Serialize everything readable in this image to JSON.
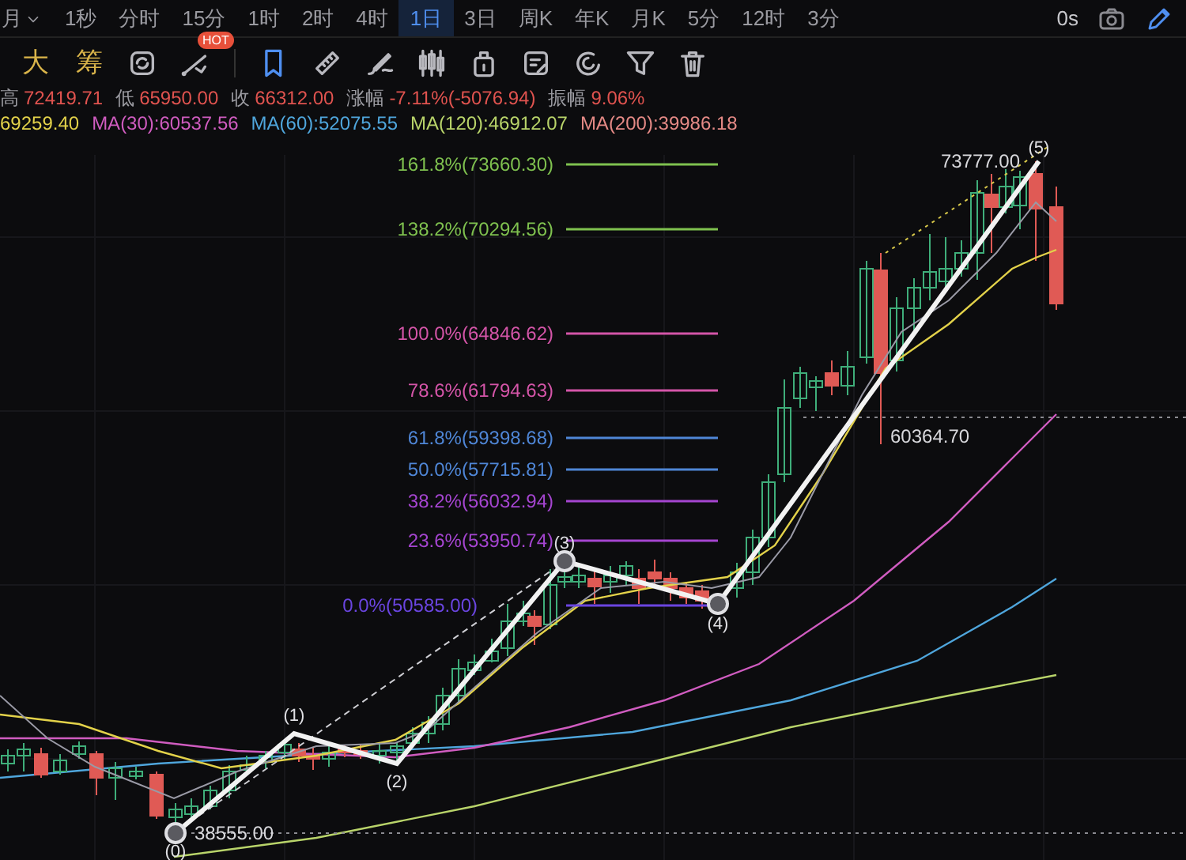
{
  "header": {
    "period_menu": "月",
    "tabs": [
      {
        "label": "1秒",
        "selected": false
      },
      {
        "label": "分时",
        "selected": false
      },
      {
        "label": "15分",
        "selected": false
      },
      {
        "label": "1时",
        "selected": false
      },
      {
        "label": "2时",
        "selected": false
      },
      {
        "label": "4时",
        "selected": false
      },
      {
        "label": "1日",
        "selected": true
      },
      {
        "label": "3日",
        "selected": false
      },
      {
        "label": "周K",
        "selected": false
      },
      {
        "label": "年K",
        "selected": false
      },
      {
        "label": "月K",
        "selected": false
      },
      {
        "label": "5分",
        "selected": false
      },
      {
        "label": "12时",
        "selected": false
      },
      {
        "label": "3分",
        "selected": false
      }
    ],
    "timer": "0s"
  },
  "toolbar": {
    "text_tools": [
      "大",
      "筹"
    ],
    "hot_badge": "HOT"
  },
  "stats": [
    {
      "label": "高",
      "value": "72419.71"
    },
    {
      "label": "低",
      "value": "65950.00"
    },
    {
      "label": "收",
      "value": "66312.00"
    },
    {
      "label": "涨幅",
      "value": "-7.11%(-5076.94)"
    },
    {
      "label": "振幅",
      "value": "9.06%"
    }
  ],
  "moving_averages": [
    {
      "label": "69259.40",
      "color": "#e3d24a"
    },
    {
      "label": "MA(30):60537.56",
      "color": "#d05cc0"
    },
    {
      "label": "MA(60):52075.55",
      "color": "#4fa6dc"
    },
    {
      "label": "MA(120):46912.07",
      "color": "#b9d46a"
    },
    {
      "label": "MA(200):39986.18",
      "color": "#e58a86"
    }
  ],
  "chart": {
    "fib_levels": [
      {
        "label": "161.8%(73660.30)",
        "color": "#7fc14f"
      },
      {
        "label": "138.2%(70294.56)",
        "color": "#7fc14f"
      },
      {
        "label": "100.0%(64846.62)",
        "color": "#d455a8"
      },
      {
        "label": "78.6%(61794.63)",
        "color": "#d455a8"
      },
      {
        "label": "61.8%(59398.68)",
        "color": "#4f86d6"
      },
      {
        "label": "50.0%(57715.81)",
        "color": "#4f86d6"
      },
      {
        "label": "38.2%(56032.94)",
        "color": "#a545d0"
      },
      {
        "label": "23.6%(53950.74)",
        "color": "#a545d0"
      },
      {
        "label": "0.0%(50585.00)",
        "color": "#6a45e0"
      }
    ],
    "waves": [
      "(0)",
      "(1)",
      "(2)",
      "(3)",
      "(4)",
      "(5)"
    ],
    "price_labels": [
      "38555.00",
      "73777.00",
      "60364.70"
    ]
  }
}
